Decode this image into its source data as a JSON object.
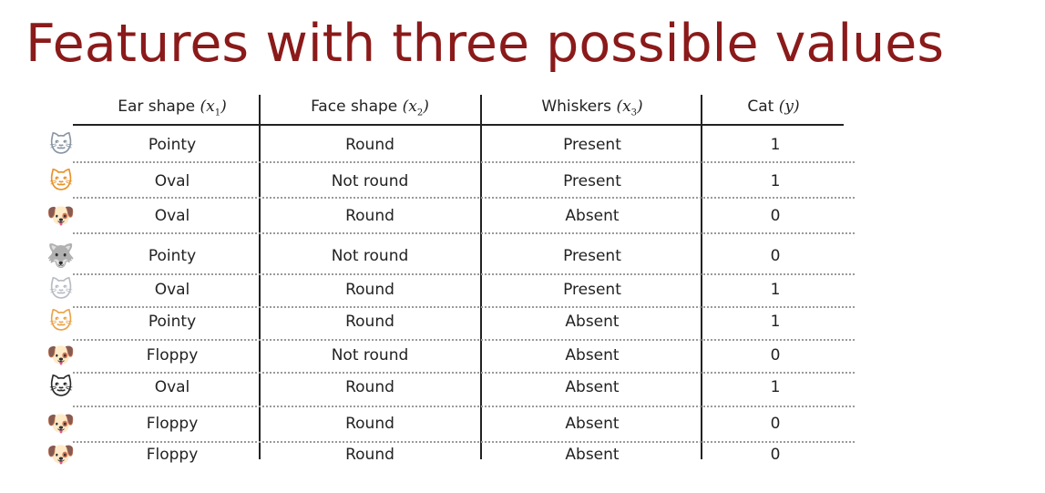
{
  "title": "Features with three possible values",
  "columns": [
    {
      "label": "Ear shape",
      "var": "x",
      "sub": "1"
    },
    {
      "label": "Face shape",
      "var": "x",
      "sub": "2"
    },
    {
      "label": "Whiskers",
      "var": "x",
      "sub": "3"
    },
    {
      "label": "Cat",
      "var": "y",
      "sub": ""
    }
  ],
  "rows": [
    {
      "icon": "gray-cat-icon",
      "ear": "Pointy",
      "face": "Round",
      "whiskers": "Present",
      "cat": "1"
    },
    {
      "icon": "orange-cat-icon",
      "ear": "Oval",
      "face": "Not round",
      "whiskers": "Present",
      "cat": "1"
    },
    {
      "icon": "fluffy-dog-icon",
      "ear": "Oval",
      "face": "Round",
      "whiskers": "Absent",
      "cat": "0"
    },
    {
      "icon": "wolf-dog-icon",
      "ear": "Pointy",
      "face": "Not round",
      "whiskers": "Present",
      "cat": "0"
    },
    {
      "icon": "white-cat-icon",
      "ear": "Oval",
      "face": "Round",
      "whiskers": "Present",
      "cat": "1"
    },
    {
      "icon": "ginger-cat-icon",
      "ear": "Pointy",
      "face": "Round",
      "whiskers": "Absent",
      "cat": "1"
    },
    {
      "icon": "golden-dog-icon",
      "ear": "Floppy",
      "face": "Not round",
      "whiskers": "Absent",
      "cat": "0"
    },
    {
      "icon": "black-white-cat-icon",
      "ear": "Oval",
      "face": "Round",
      "whiskers": "Absent",
      "cat": "1"
    },
    {
      "icon": "brown-dog-icon",
      "ear": "Floppy",
      "face": "Round",
      "whiskers": "Absent",
      "cat": "0"
    },
    {
      "icon": "shaggy-dog-icon",
      "ear": "Floppy",
      "face": "Round",
      "whiskers": "Absent",
      "cat": "0"
    }
  ],
  "icon_colors": {
    "gray-cat-icon": "#8a96a3",
    "orange-cat-icon": "#e8922a",
    "fluffy-dog-icon": "#b8a894",
    "wolf-dog-icon": "#7d7a78",
    "white-cat-icon": "#b9bcc4",
    "ginger-cat-icon": "#e9a44a",
    "golden-dog-icon": "#e3b46a",
    "black-white-cat-icon": "#2a2a2a",
    "brown-dog-icon": "#8b5a3a",
    "shaggy-dog-icon": "#c8c4bc"
  },
  "title_color": "#8b1a1a"
}
